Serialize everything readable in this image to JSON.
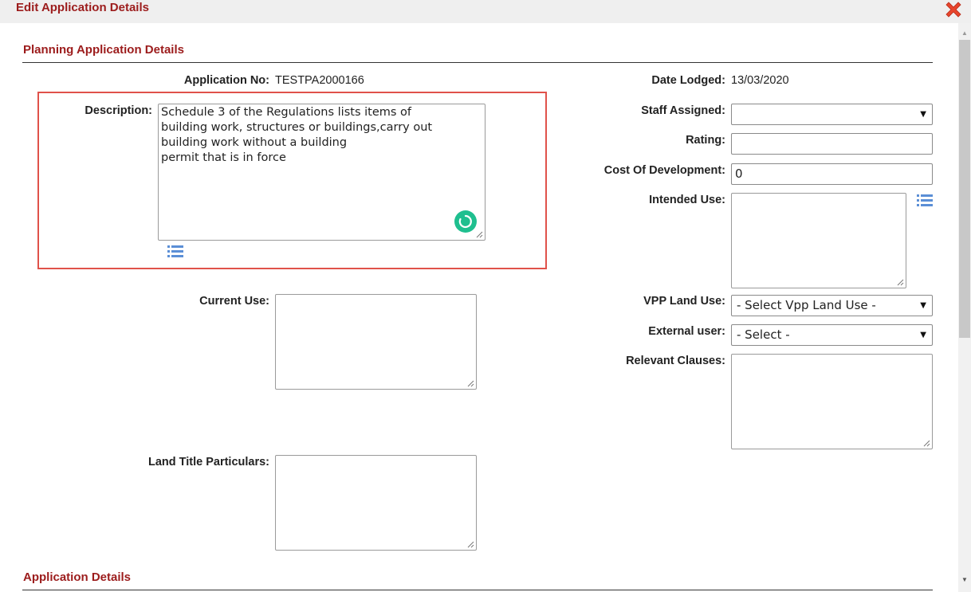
{
  "dialog": {
    "title": "Edit Application Details",
    "close_icon": "close-x-icon",
    "accent_color": "#9c1c1c",
    "close_color": "#e8452c"
  },
  "planning_section": {
    "header": "Planning Application Details",
    "application_no": {
      "label": "Application No:",
      "value": "TESTPA2000166"
    },
    "date_lodged": {
      "label": "Date Lodged:",
      "value": "13/03/2020"
    },
    "description": {
      "label": "Description:",
      "value": "Schedule 3 of the Regulations lists items of\nbuilding work, structures or buildings,carry out\nbuilding work without a building\npermit that is in force",
      "highlight_color": "#e0524a"
    },
    "staff_assigned": {
      "label": "Staff Assigned:",
      "value": ""
    },
    "rating": {
      "label": "Rating:",
      "value": ""
    },
    "cost_of_development": {
      "label": "Cost Of Development:",
      "value": "0"
    },
    "intended_use": {
      "label": "Intended Use:",
      "value": ""
    },
    "current_use": {
      "label": "Current Use:",
      "value": ""
    },
    "vpp_land_use": {
      "label": "VPP Land Use:",
      "value": "- Select Vpp Land Use -"
    },
    "external_user": {
      "label": "External user:",
      "value": "- Select -"
    },
    "relevant_clauses": {
      "label": "Relevant Clauses:",
      "value": ""
    },
    "land_title_particulars": {
      "label": "Land Title Particulars:",
      "value": ""
    }
  },
  "application_section": {
    "header": "Application Details"
  },
  "icons": {
    "list_icon": "list-icon",
    "spinner_icon": "grammar-check-spinner-icon",
    "spinner_color": "#1fbf8f"
  }
}
